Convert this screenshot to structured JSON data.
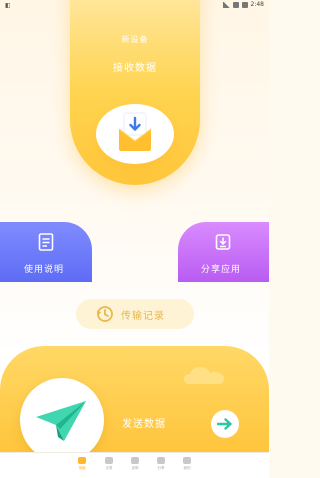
{
  "status_bar": {
    "left_icon": "notification-icon",
    "time": "2:48"
  },
  "hero": {
    "subtitle": "新设备",
    "title": "接收数据",
    "icon": "inbox-download-icon"
  },
  "cards": {
    "left": {
      "label": "使用说明",
      "icon": "document-icon"
    },
    "right": {
      "label": "分享应用",
      "icon": "share-download-icon"
    }
  },
  "history": {
    "label": "传输记录",
    "icon": "history-clock-icon"
  },
  "send": {
    "label": "发送数据",
    "icon": "paper-plane-icon",
    "action_icon": "arrow-right-icon"
  },
  "bottom_nav": {
    "items": [
      {
        "label": "传输",
        "active": true
      },
      {
        "label": "记录",
        "active": false
      },
      {
        "label": "说明",
        "active": false
      },
      {
        "label": "分享",
        "active": false
      },
      {
        "label": "我的",
        "active": false
      }
    ]
  },
  "colors": {
    "accent": "#ffc43a",
    "left_card": "#6b78f7",
    "right_card": "#c472f5",
    "history_text": "#e6b94a"
  }
}
